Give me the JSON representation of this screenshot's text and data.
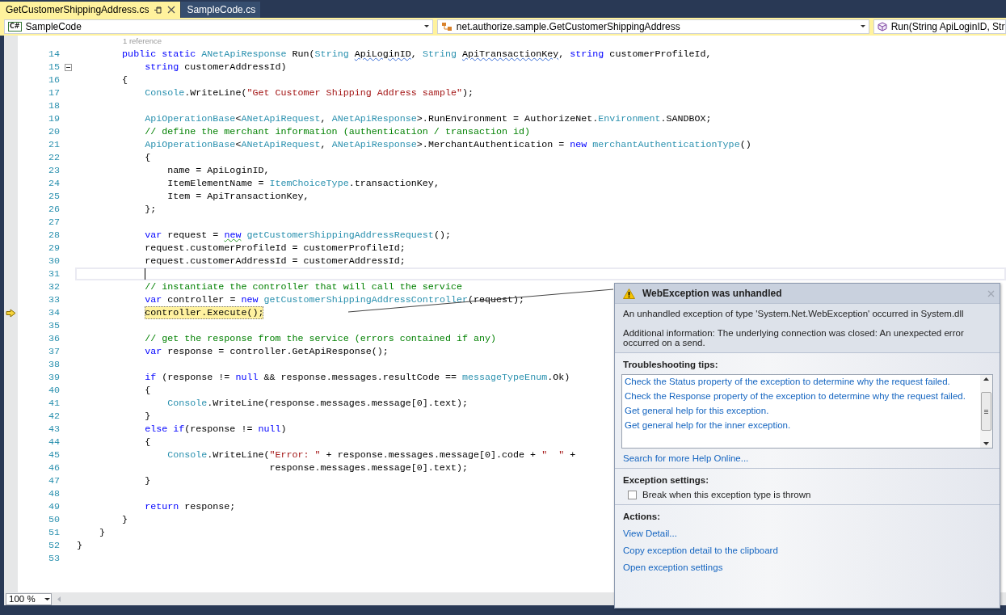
{
  "tabs": [
    {
      "label": "GetCustomerShippingAddress.cs",
      "selected": true
    },
    {
      "label": "SampleCode.cs",
      "selected": false
    }
  ],
  "navigation_bar": {
    "project": {
      "badge": "C#",
      "value": "SampleCode"
    },
    "type": {
      "value": "net.authorize.sample.GetCustomerShippingAddress"
    },
    "member": {
      "value": "Run(String ApiLoginID, Str"
    }
  },
  "editor": {
    "codelens": "1 reference",
    "lines": [
      {
        "number": "14",
        "kind": "normal",
        "tokens": [
          {
            "kind": "kw",
            "text": "        public static "
          },
          {
            "kind": "type",
            "text": "ANetApiResponse"
          },
          {
            "kind": "plain",
            "text": " Run("
          },
          {
            "kind": "type",
            "text": "String "
          },
          {
            "kind": "plain",
            "text": "ApiLoginID",
            "warning": true
          },
          {
            "kind": "plain",
            "text": ", "
          },
          {
            "kind": "type",
            "text": "String "
          },
          {
            "kind": "plain",
            "text": "ApiTransactionKey",
            "warning": true
          },
          {
            "kind": "plain",
            "text": ", "
          },
          {
            "kind": "kw",
            "text": "string"
          },
          {
            "kind": "plain",
            "text": " customerProfileId,"
          }
        ]
      },
      {
        "number": "15",
        "kind": "normal",
        "expanded": true,
        "tokens": [
          {
            "kind": "kw",
            "text": "            string"
          },
          {
            "kind": "plain",
            "text": " customerAddressId)"
          }
        ]
      },
      {
        "number": "16",
        "kind": "normal",
        "tokens": [
          {
            "kind": "plain",
            "text": "        {"
          }
        ]
      },
      {
        "number": "17",
        "kind": "normal",
        "tokens": [
          {
            "kind": "type",
            "text": "            Console"
          },
          {
            "kind": "plain",
            "text": ".WriteLine("
          },
          {
            "kind": "str",
            "text": "\"Get Customer Shipping Address sample\""
          },
          {
            "kind": "plain",
            "text": ");"
          }
        ]
      },
      {
        "number": "18",
        "kind": "normal"
      },
      {
        "number": "19",
        "kind": "normal",
        "tokens": [
          {
            "kind": "type",
            "text": "            ApiOperationBase"
          },
          {
            "kind": "plain",
            "text": "<"
          },
          {
            "kind": "type",
            "text": "ANetApiRequest"
          },
          {
            "kind": "plain",
            "text": ", "
          },
          {
            "kind": "type",
            "text": "ANetApiResponse"
          },
          {
            "kind": "plain",
            "text": ">.RunEnvironment = AuthorizeNet."
          },
          {
            "kind": "type",
            "text": "Environment"
          },
          {
            "kind": "plain",
            "text": ".SANDBOX;"
          }
        ]
      },
      {
        "number": "20",
        "kind": "normal",
        "tokens": [
          {
            "kind": "comment",
            "text": "            // define the merchant information (authentication / transaction id)"
          }
        ]
      },
      {
        "number": "21",
        "kind": "normal",
        "tokens": [
          {
            "kind": "type",
            "text": "            ApiOperationBase"
          },
          {
            "kind": "plain",
            "text": "<"
          },
          {
            "kind": "type",
            "text": "ANetApiRequest"
          },
          {
            "kind": "plain",
            "text": ", "
          },
          {
            "kind": "type",
            "text": "ANetApiResponse"
          },
          {
            "kind": "plain",
            "text": ">.MerchantAuthentication = "
          },
          {
            "kind": "kw",
            "text": "new "
          },
          {
            "kind": "type",
            "text": "merchantAuthenticationType"
          },
          {
            "kind": "plain",
            "text": "()"
          }
        ]
      },
      {
        "number": "22",
        "kind": "normal",
        "tokens": [
          {
            "kind": "plain",
            "text": "            {"
          }
        ]
      },
      {
        "number": "23",
        "kind": "normal",
        "tokens": [
          {
            "kind": "plain",
            "text": "                name = ApiLoginID,"
          }
        ]
      },
      {
        "number": "24",
        "kind": "normal",
        "tokens": [
          {
            "kind": "plain",
            "text": "                ItemElementName = "
          },
          {
            "kind": "type",
            "text": "ItemChoiceType"
          },
          {
            "kind": "plain",
            "text": ".transactionKey,"
          }
        ]
      },
      {
        "number": "25",
        "kind": "normal",
        "tokens": [
          {
            "kind": "plain",
            "text": "                Item = ApiTransactionKey,"
          }
        ]
      },
      {
        "number": "26",
        "kind": "normal",
        "tokens": [
          {
            "kind": "plain",
            "text": "            };"
          }
        ]
      },
      {
        "number": "27",
        "kind": "normal"
      },
      {
        "number": "28",
        "kind": "normal",
        "tokens": [
          {
            "kind": "kw",
            "text": "            var"
          },
          {
            "kind": "plain",
            "text": " request = "
          },
          {
            "kind": "kw",
            "text": "new",
            "suggestion": true
          },
          {
            "kind": "type",
            "text": " getCustomerShippingAddressRequest"
          },
          {
            "kind": "plain",
            "text": "();"
          }
        ]
      },
      {
        "number": "29",
        "kind": "normal",
        "tokens": [
          {
            "kind": "plain",
            "text": "            request.customerProfileId = customerProfileId;"
          }
        ]
      },
      {
        "number": "30",
        "kind": "normal",
        "tokens": [
          {
            "kind": "plain",
            "text": "            request.customerAddressId = customerAddressId;"
          }
        ]
      },
      {
        "number": "31",
        "kind": "current"
      },
      {
        "number": "32",
        "kind": "normal",
        "tokens": [
          {
            "kind": "comment",
            "text": "            // instantiate the controller that will call the service"
          }
        ]
      },
      {
        "number": "33",
        "kind": "normal",
        "tokens": [
          {
            "kind": "kw",
            "text": "            var"
          },
          {
            "kind": "plain",
            "text": " controller = "
          },
          {
            "kind": "kw",
            "text": "new "
          },
          {
            "kind": "type",
            "text": "getCustomerShippingAddressController"
          },
          {
            "kind": "plain",
            "text": "(request);"
          }
        ]
      },
      {
        "number": "34",
        "kind": "next_statement",
        "tokens": [
          {
            "kind": "plain",
            "text": "controller.Execute();"
          }
        ]
      },
      {
        "number": "35",
        "kind": "normal"
      },
      {
        "number": "36",
        "kind": "normal",
        "tokens": [
          {
            "kind": "comment",
            "text": "            // get the response from the service (errors contained if any)"
          }
        ]
      },
      {
        "number": "37",
        "kind": "normal",
        "tokens": [
          {
            "kind": "kw",
            "text": "            var"
          },
          {
            "kind": "plain",
            "text": " response = controller.GetApiResponse();"
          }
        ]
      },
      {
        "number": "38",
        "kind": "normal"
      },
      {
        "number": "39",
        "kind": "normal",
        "tokens": [
          {
            "kind": "kw",
            "text": "            if"
          },
          {
            "kind": "plain",
            "text": " (response != "
          },
          {
            "kind": "kw",
            "text": "null"
          },
          {
            "kind": "plain",
            "text": " && response.messages.resultCode == "
          },
          {
            "kind": "type",
            "text": "messageTypeEnum"
          },
          {
            "kind": "plain",
            "text": ".Ok)"
          }
        ]
      },
      {
        "number": "40",
        "kind": "normal",
        "tokens": [
          {
            "kind": "plain",
            "text": "            {"
          }
        ]
      },
      {
        "number": "41",
        "kind": "normal",
        "tokens": [
          {
            "kind": "type",
            "text": "                Console"
          },
          {
            "kind": "plain",
            "text": ".WriteLine(response.messages.message[0].text);"
          }
        ]
      },
      {
        "number": "42",
        "kind": "normal",
        "tokens": [
          {
            "kind": "plain",
            "text": "            }"
          }
        ]
      },
      {
        "number": "43",
        "kind": "normal",
        "tokens": [
          {
            "kind": "kw",
            "text": "            else if"
          },
          {
            "kind": "plain",
            "text": "(response != "
          },
          {
            "kind": "kw",
            "text": "null"
          },
          {
            "kind": "plain",
            "text": ")"
          }
        ]
      },
      {
        "number": "44",
        "kind": "normal",
        "tokens": [
          {
            "kind": "plain",
            "text": "            {"
          }
        ]
      },
      {
        "number": "45",
        "kind": "normal",
        "tokens": [
          {
            "kind": "type",
            "text": "                Console"
          },
          {
            "kind": "plain",
            "text": ".WriteLine("
          },
          {
            "kind": "str",
            "text": "\"Error: \""
          },
          {
            "kind": "plain",
            "text": " + response.messages.message[0].code + "
          },
          {
            "kind": "str",
            "text": "\"  \""
          },
          {
            "kind": "plain",
            "text": " +"
          }
        ]
      },
      {
        "number": "46",
        "kind": "normal",
        "tokens": [
          {
            "kind": "plain",
            "text": "                                  response.messages.message[0].text);"
          }
        ]
      },
      {
        "number": "47",
        "kind": "normal",
        "tokens": [
          {
            "kind": "plain",
            "text": "            }"
          }
        ]
      },
      {
        "number": "48",
        "kind": "normal"
      },
      {
        "number": "49",
        "kind": "normal",
        "tokens": [
          {
            "kind": "kw",
            "text": "            return"
          },
          {
            "kind": "plain",
            "text": " response;"
          }
        ]
      },
      {
        "number": "50",
        "kind": "normal",
        "tokens": [
          {
            "kind": "plain",
            "text": "        }"
          }
        ]
      },
      {
        "number": "51",
        "kind": "normal",
        "tokens": [
          {
            "kind": "plain",
            "text": "    }"
          }
        ]
      },
      {
        "number": "52",
        "kind": "normal",
        "tokens": [
          {
            "kind": "plain",
            "text": "}"
          }
        ]
      },
      {
        "number": "53",
        "kind": "normal"
      }
    ]
  },
  "zoom": {
    "value": "100 %"
  },
  "exception_popup": {
    "title": "WebException was unhandled",
    "message": "An unhandled exception of type 'System.Net.WebException' occurred in System.dll",
    "additional_info": "Additional information: The underlying connection was closed: An unexpected error occurred on a send.",
    "tips_heading": "Troubleshooting tips:",
    "tips": [
      "Check the Status property of the exception to determine why the request failed.",
      "Check the Response property of the exception to determine why the request failed.",
      "Get general help for this exception.",
      "Get general help for the inner exception."
    ],
    "search_link": "Search for more Help Online...",
    "settings_heading": "Exception settings:",
    "break_option": {
      "label": "Break when this exception type is thrown",
      "checked": false
    },
    "actions_heading": "Actions:",
    "actions": [
      "View Detail...",
      "Copy exception detail to the clipboard",
      "Open exception settings"
    ]
  }
}
